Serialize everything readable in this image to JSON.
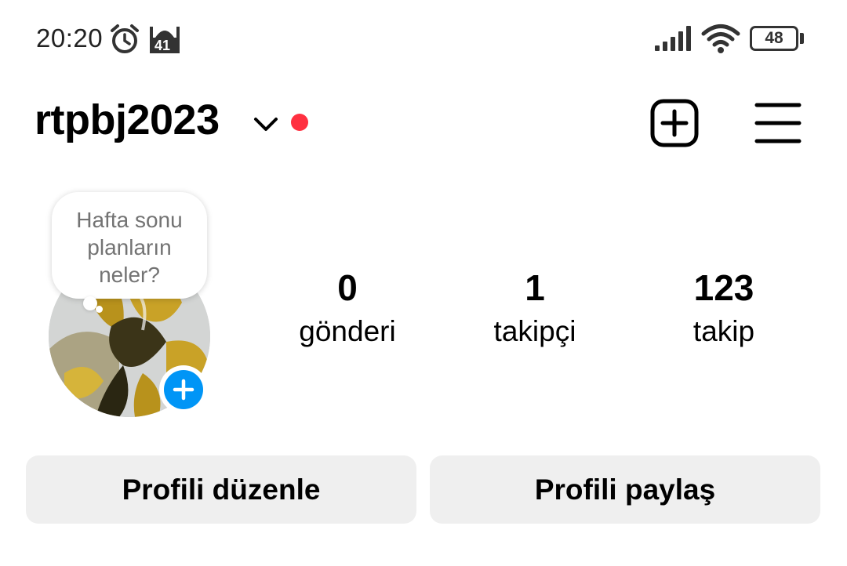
{
  "status_bar": {
    "time": "20:20",
    "notification_badge": "41",
    "battery_level": "48",
    "icons": [
      "alarm-icon",
      "mosque-icon",
      "signal-icon",
      "wifi-icon",
      "battery-icon"
    ]
  },
  "header": {
    "username": "rtpbj2023",
    "icons": [
      "chevron-down-icon",
      "add-post-icon",
      "menu-icon"
    ],
    "notification_dot_color": "#ff3040"
  },
  "note": {
    "text_line1": "Hafta sonu",
    "text_line2": "planların",
    "text_line3": "neler?"
  },
  "profile": {
    "avatar_add_story_color": "#0095f6"
  },
  "stats": {
    "posts_value": "0",
    "posts_label": "gönderi",
    "followers_value": "1",
    "followers_label": "takipçi",
    "following_value": "123",
    "following_label": "takip"
  },
  "actions": {
    "edit_profile": "Profili düzenle",
    "share_profile": "Profili paylaş"
  }
}
